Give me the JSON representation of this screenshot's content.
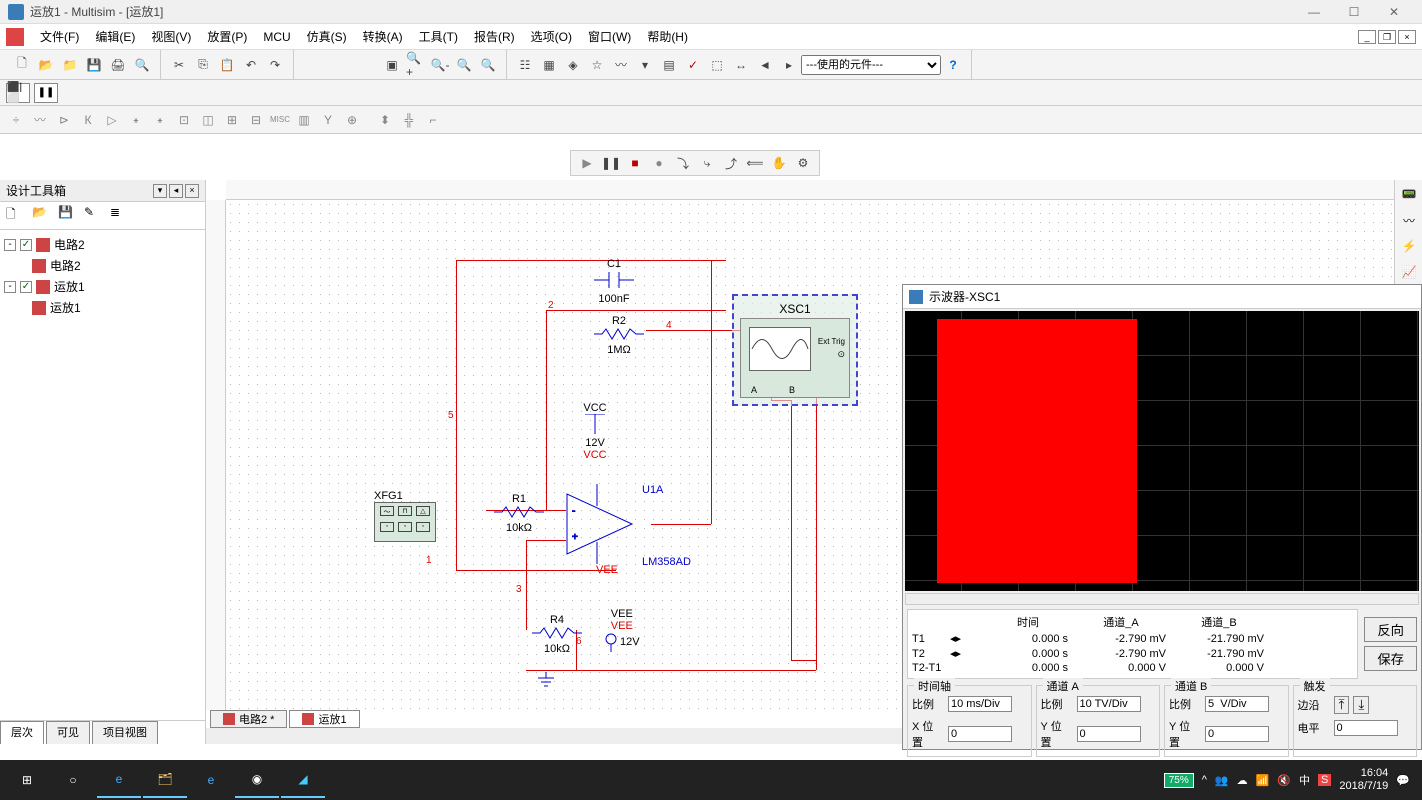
{
  "app": {
    "title": "运放1 - Multisim - [运放1]"
  },
  "menu": {
    "items": [
      "文件(F)",
      "编辑(E)",
      "视图(V)",
      "放置(P)",
      "MCU",
      "仿真(S)",
      "转换(A)",
      "工具(T)",
      "报告(R)",
      "选项(O)",
      "窗口(W)",
      "帮助(H)"
    ]
  },
  "toolbar": {
    "component_dropdown": "---使用的元件---"
  },
  "sidebar": {
    "title": "设计工具箱",
    "tree": [
      {
        "label": "电路2",
        "children": [
          {
            "label": "电路2"
          }
        ]
      },
      {
        "label": "运放1",
        "children": [
          {
            "label": "运放1"
          }
        ]
      }
    ],
    "tabs": [
      "层次",
      "可见",
      "项目视图"
    ]
  },
  "canvas": {
    "tabs": [
      "电路2 *",
      "运放1"
    ],
    "components": {
      "C1": {
        "name": "C1",
        "value": "100nF"
      },
      "R2": {
        "name": "R2",
        "value": "1MΩ"
      },
      "R1": {
        "name": "R1",
        "value": "10kΩ"
      },
      "R4": {
        "name": "R4",
        "value": "10kΩ"
      },
      "VCC": {
        "name": "VCC",
        "value": "12V",
        "net": "VCC"
      },
      "VEE": {
        "name": "VEE",
        "value": "12V",
        "net": "VEE"
      },
      "U1A": {
        "name": "U1A",
        "model": "LM358AD"
      },
      "XFG1": {
        "name": "XFG1"
      },
      "XSC1": {
        "name": "XSC1",
        "ext": "Ext Trig",
        "chA": "A",
        "chB": "B"
      }
    },
    "nets": {
      "n1": "1",
      "n2": "2",
      "n3": "3",
      "n4": "4",
      "n5": "5",
      "n6": "6"
    }
  },
  "scope": {
    "title": "示波器-XSC1",
    "table": {
      "headers": {
        "time": "时间",
        "chA": "通道_A",
        "chB": "通道_B"
      },
      "rows": {
        "T1": {
          "label": "T1",
          "time": "0.000 s",
          "a": "-2.790 mV",
          "b": "-21.790 mV"
        },
        "T2": {
          "label": "T2",
          "time": "0.000 s",
          "a": "-2.790 mV",
          "b": "-21.790 mV"
        },
        "dT": {
          "label": "T2-T1",
          "time": "0.000 s",
          "a": "0.000 V",
          "b": "0.000 V"
        }
      }
    },
    "buttons": {
      "reverse": "反向",
      "save": "保存"
    },
    "sections": {
      "timebase": {
        "legend": "时间轴",
        "scale_label": "比例",
        "scale": "10 ms/Div",
        "xpos_label": "X 位置",
        "xpos": "0"
      },
      "chA": {
        "legend": "通道 A",
        "scale_label": "比例",
        "scale": "10 TV/Div",
        "ypos_label": "Y 位置",
        "ypos": "0"
      },
      "chB": {
        "legend": "通道 B",
        "scale_label": "比例",
        "scale": "5  V/Div",
        "ypos_label": "Y 位置",
        "ypos": "0"
      },
      "trigger": {
        "legend": "触发",
        "edge_label": "边沿",
        "level_label": "电平",
        "level": "0"
      }
    }
  },
  "taskbar": {
    "battery": "75%",
    "time": "16:04",
    "date": "2018/7/19",
    "ime": "中"
  }
}
